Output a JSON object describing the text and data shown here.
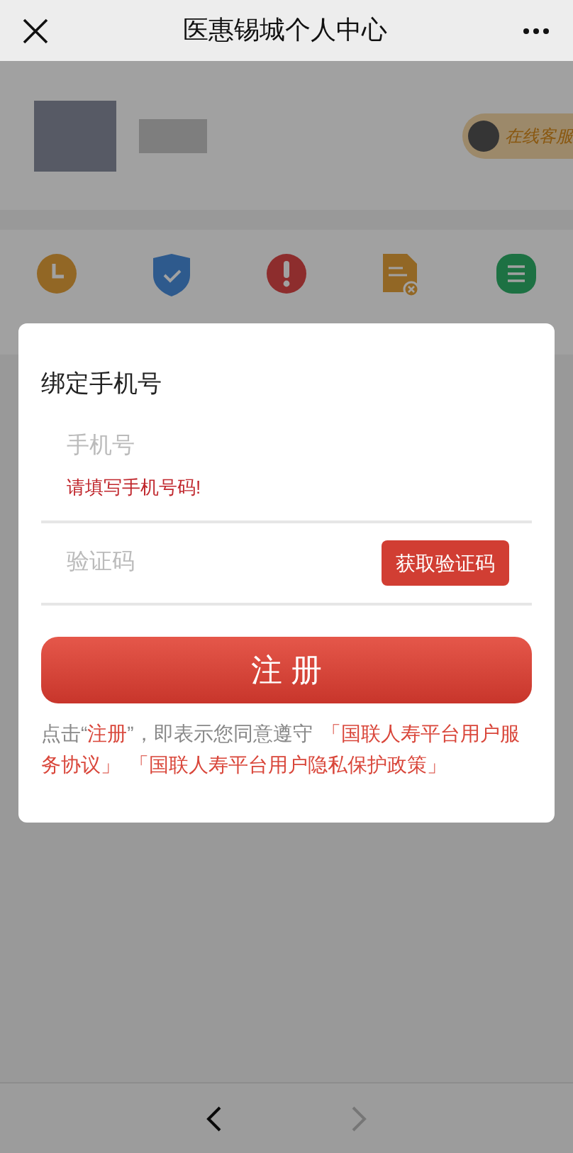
{
  "nav_bar": {
    "title": "医惠锡城个人中心"
  },
  "profile": {
    "service_badge": "在线客服"
  },
  "order_shortcuts": [
    {
      "kind": "clock"
    },
    {
      "kind": "shield"
    },
    {
      "kind": "alert"
    },
    {
      "kind": "doc"
    },
    {
      "kind": "list"
    }
  ],
  "dialog": {
    "title": "绑定手机号",
    "phone_field": {
      "placeholder": "手机号",
      "error": "请填写手机号码!"
    },
    "code_field": {
      "placeholder": "验证码",
      "button": "获取验证码"
    },
    "submit_button": "注 册",
    "agreement": [
      {
        "text": "点击“",
        "highlight": false
      },
      {
        "text": "注册",
        "highlight": true
      },
      {
        "text": "”，即表示您同意遵守",
        "highlight": false
      },
      {
        "text": "「国联人寿平台用户服务协议」",
        "highlight": true
      },
      {
        "text": "「国联人寿平台用户隐私保护政策」",
        "highlight": true
      }
    ]
  },
  "bottom_bar": {
    "back_enabled": true,
    "forward_enabled": false
  }
}
